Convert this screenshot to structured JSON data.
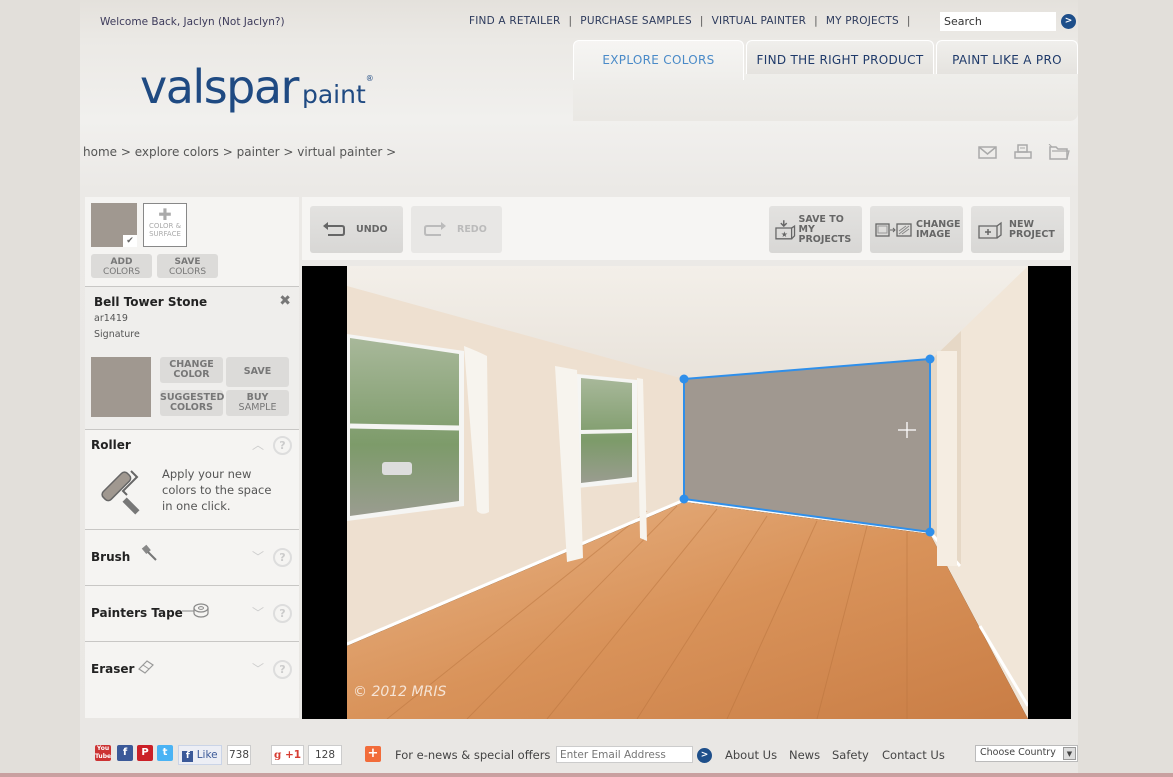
{
  "header": {
    "welcome": "Welcome Back, Jaclyn (Not Jaclyn?)",
    "top_links": [
      "FIND A RETAILER",
      "PURCHASE SAMPLES",
      "VIRTUAL PAINTER",
      "MY PROJECTS"
    ],
    "search_placeholder": "Search",
    "search_go": ">",
    "logo_main": "valspar",
    "logo_sub": "paint",
    "logo_reg": "®",
    "tabs": [
      {
        "label": "EXPLORE COLORS",
        "active": true
      },
      {
        "label": "FIND THE RIGHT PRODUCT",
        "active": false
      },
      {
        "label": "PAINT LIKE A PRO",
        "active": false
      }
    ]
  },
  "breadcrumb": "home > explore colors > painter > virtual painter >",
  "utility_icons": [
    "email-icon",
    "print-icon",
    "folder-icon"
  ],
  "left_panel": {
    "swatch_color": "#a09890",
    "color_surface_label_1": "COLOR &",
    "color_surface_label_2": "SURFACE",
    "add_colors": [
      "ADD",
      "COLORS"
    ],
    "save_colors": [
      "SAVE",
      "COLORS"
    ],
    "selected_color": {
      "name": "Bell Tower Stone",
      "code": "ar1419",
      "line": "Signature",
      "hex": "#a09890"
    },
    "actions": {
      "change_color": [
        "CHANGE",
        "COLOR"
      ],
      "save": "SAVE",
      "suggested_colors": [
        "SUGGESTED",
        "COLORS"
      ],
      "buy_sample": [
        "BUY",
        "SAMPLE"
      ]
    },
    "tools": [
      {
        "name": "Roller",
        "expanded": true,
        "description": "Apply your new colors to the space in one click."
      },
      {
        "name": "Brush",
        "expanded": false
      },
      {
        "name": "Painters Tape",
        "expanded": false
      },
      {
        "name": "Eraser",
        "expanded": false
      }
    ],
    "help_glyph": "?"
  },
  "toolbar": {
    "undo": "UNDO",
    "redo": "REDO",
    "save_to_projects": [
      "SAVE TO MY",
      "PROJECTS"
    ],
    "change_image": [
      "CHANGE",
      "IMAGE"
    ],
    "new_project": [
      "NEW",
      "PROJECT"
    ]
  },
  "canvas": {
    "watermark": "© 2012 MRIS",
    "wall_color": "#a09890",
    "selection_color": "#2f8fea"
  },
  "footer": {
    "fb_like": "Like",
    "fb_count": "738",
    "gplus": "+1",
    "gplus_count": "128",
    "enews_label": "For e-news & special offers",
    "email_placeholder": "Enter Email Address",
    "links": [
      "About Us",
      "News",
      "Safety",
      "Contact Us"
    ],
    "country_select": "Choose Country"
  }
}
